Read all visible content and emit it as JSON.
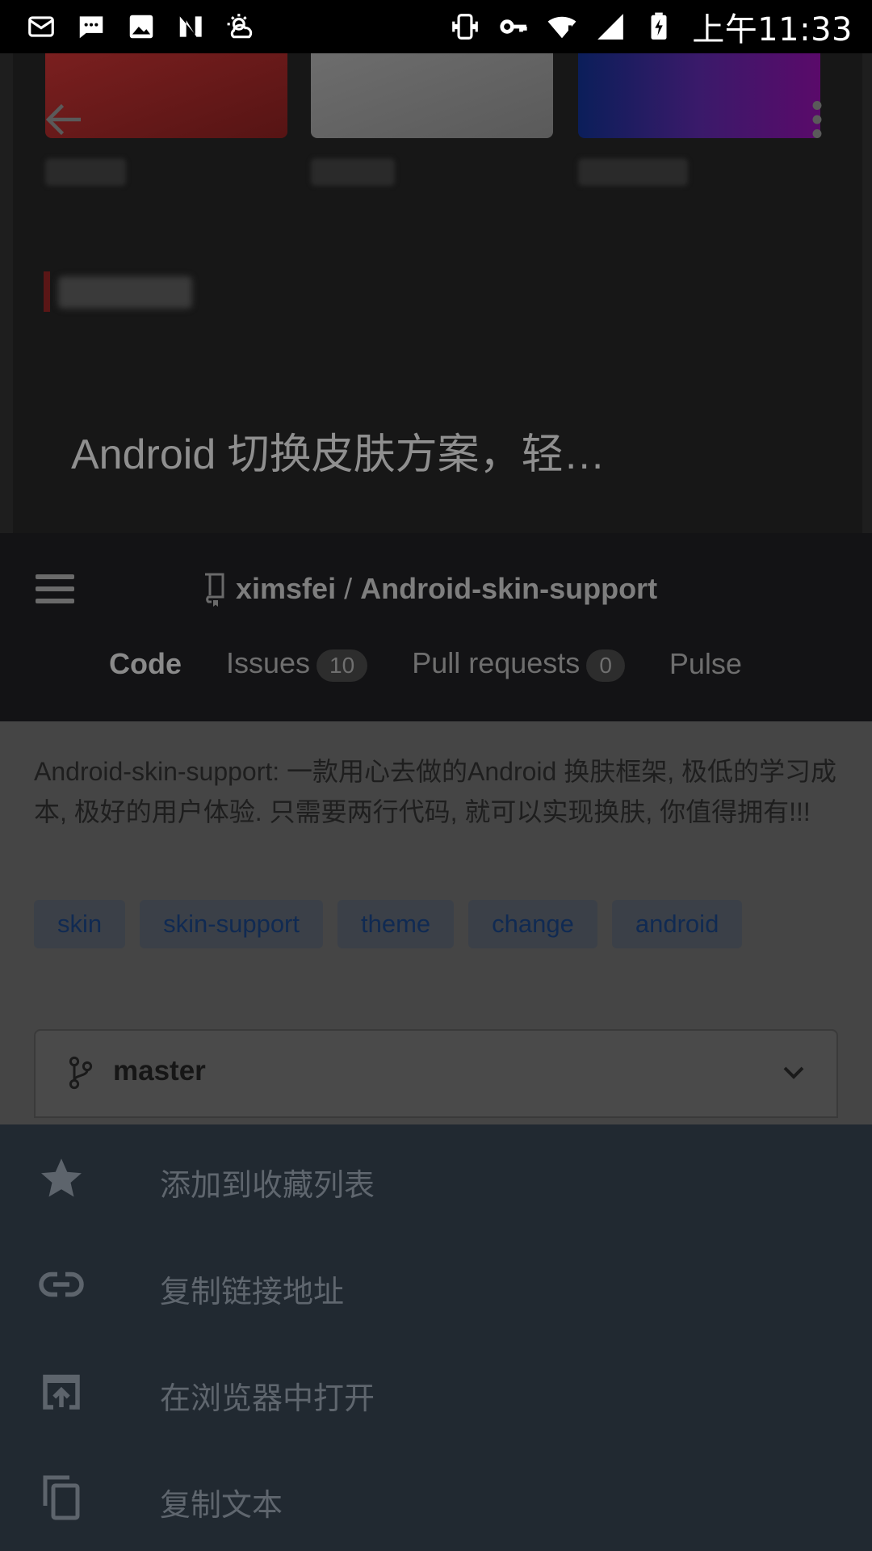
{
  "status_bar": {
    "time": "上午11:33",
    "left_icons": [
      "mail-icon",
      "message-icon",
      "image-icon",
      "n-app-icon",
      "weather-icon"
    ],
    "right_icons": [
      "vibrate-icon",
      "vpn-key-icon",
      "wifi-alert-icon",
      "signal-icon",
      "battery-charging-icon"
    ]
  },
  "top_preview": {
    "text": "Android 切换皮肤方案，轻…",
    "swatch_colors": [
      "#7a1f1f",
      "#6d6d6d",
      "#3a1a6a"
    ]
  },
  "repo": {
    "owner": "ximsfei",
    "separator": "/",
    "name": "Android-skin-support"
  },
  "tabs": [
    {
      "label": "Code",
      "active": true
    },
    {
      "label": "Issues",
      "count": "10"
    },
    {
      "label": "Pull requests",
      "count": "0"
    },
    {
      "label": "Pulse"
    }
  ],
  "description": "Android-skin-support: 一款用心去做的Android 换肤框架, 极低的学习成本, 极好的用户体验. 只需要两行代码, 就可以实现换肤, 你值得拥有!!!",
  "topics": [
    "skin",
    "skin-support",
    "theme",
    "change",
    "android"
  ],
  "branch": {
    "name": "master"
  },
  "sheet": {
    "items": [
      {
        "icon": "star-icon",
        "label": "添加到收藏列表"
      },
      {
        "icon": "link-icon",
        "label": "复制链接地址"
      },
      {
        "icon": "open-in-browser-icon",
        "label": "在浏览器中打开"
      },
      {
        "icon": "copy-icon",
        "label": "复制文本"
      }
    ]
  },
  "colors": {
    "sheet_background": "#212931",
    "header_background": "#131315",
    "topic_text": "#102a52"
  }
}
